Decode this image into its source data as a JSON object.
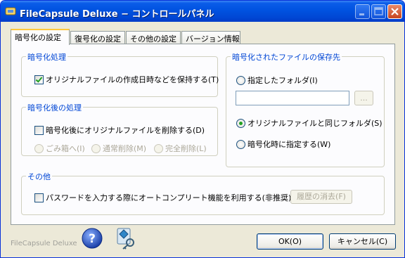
{
  "window": {
    "title": "FileCapsule Deluxe − コントロールパネル",
    "controls": [
      "minimize-icon",
      "maximize-icon",
      "close-icon"
    ]
  },
  "tabs": [
    {
      "label": "暗号化の設定",
      "active": true
    },
    {
      "label": "復号化の設定",
      "active": false
    },
    {
      "label": "その他の設定",
      "active": false
    },
    {
      "label": "バージョン情報",
      "active": false
    }
  ],
  "encryption": {
    "title": "暗号化処理",
    "keep_date_label": "オリジナルファイルの作成日時などを保持する(T)",
    "keep_date_checked": true
  },
  "post": {
    "title": "暗号化後の処理",
    "delete_label": "暗号化後にオリジナルファイルを削除する(D)",
    "delete_checked": false,
    "modes": [
      "ごみ箱へ(I)",
      "通常削除(M)",
      "完全削除(L)"
    ]
  },
  "save": {
    "title": "暗号化されたファイルの保存先",
    "specified_folder_label": "指定したフォルダ(I)",
    "folder_value": "",
    "browse_label": "...",
    "same_folder_label": "オリジナルファイルと同じフォルダ(S)",
    "specify_on_encrypt_label": "暗号化時に指定する(W)",
    "selected": "same_folder"
  },
  "other": {
    "title": "その他",
    "autocomplete_label": "パスワードを入力する際にオートコンプリート機能を利用する(非推奨)(A)",
    "autocomplete_checked": false,
    "clear_history_label": "履歴の消去(F)"
  },
  "footer": {
    "brand": "FileCapsule Deluxe",
    "ok_label": "OK(O)",
    "cancel_label": "キャンセル(C)"
  },
  "colors": {
    "titlebar": "#0052e0",
    "group_title": "#0046d5",
    "tab_highlight": "#ffc83c",
    "face": "#ece9d8"
  }
}
